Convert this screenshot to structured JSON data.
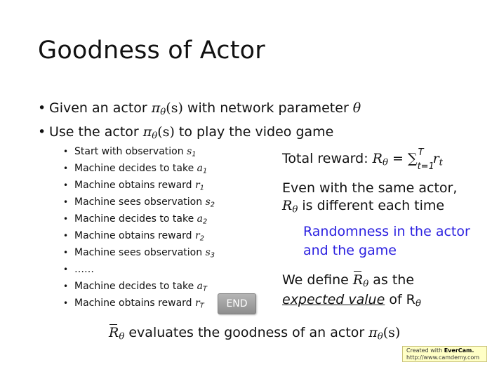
{
  "slide": {
    "title": "Goodness of Actor",
    "bullets": [
      {
        "text_a": "Given an actor ",
        "math_a": "π",
        "math_a_sub": "θ",
        "math_a_arg": "(s)",
        "text_b": " with network parameter ",
        "math_b": "θ"
      },
      {
        "text_a": "Use the actor ",
        "math_a": "π",
        "math_a_sub": "θ",
        "math_a_arg": "(s)",
        "text_b": " to play the video game"
      }
    ],
    "sub_bullets": [
      {
        "text": "Start with observation ",
        "var": "s",
        "sub": "1"
      },
      {
        "text": "Machine decides to take ",
        "var": "a",
        "sub": "1"
      },
      {
        "text": "Machine obtains reward ",
        "var": "r",
        "sub": "1"
      },
      {
        "text": "Machine sees observation ",
        "var": "s",
        "sub": "2"
      },
      {
        "text": "Machine decides to take ",
        "var": "a",
        "sub": "2"
      },
      {
        "text": "Machine obtains reward ",
        "var": "r",
        "sub": "2"
      },
      {
        "text": "Machine sees observation ",
        "var": "s",
        "sub": "3"
      },
      {
        "text": "……",
        "var": "",
        "sub": ""
      },
      {
        "text": "Machine decides to take ",
        "var": "a",
        "sub": "T"
      },
      {
        "text": "Machine obtains reward ",
        "var": "r",
        "sub": "T"
      }
    ],
    "end_button": "END",
    "total_reward": {
      "label": "Total reward: ",
      "lhs": "R",
      "lhs_sub": "θ",
      "eq": " = ∑",
      "sum_sub": "t=1",
      "sum_sup": "T",
      "term": "r",
      "term_sub": "t"
    },
    "even_line1": "Even with the same actor,",
    "even_line2_var": "R",
    "even_line2_sub": "θ",
    "even_line2_text": " is different each time",
    "random_line1": "Randomness in the actor",
    "random_line2": "and the game",
    "define_line1_a": "We define ",
    "define_line1_var": "R",
    "define_line1_sub": "θ",
    "define_line1_b": " as the",
    "define_line2_a": "expected value",
    "define_line2_b": " of R",
    "define_line2_sub": "θ",
    "bottom_var": "R",
    "bottom_sub": "θ",
    "bottom_text": " evaluates the goodness of an actor ",
    "bottom_pi": "π",
    "bottom_pi_sub": "θ",
    "bottom_arg": "(s)",
    "colors": {
      "highlight": "#2a1fe0",
      "end_button": "#9e9e9e"
    }
  },
  "watermark": {
    "line1_a": "Created with ",
    "line1_b": "EverCam.",
    "line2": "http://www.camdemy.com"
  }
}
